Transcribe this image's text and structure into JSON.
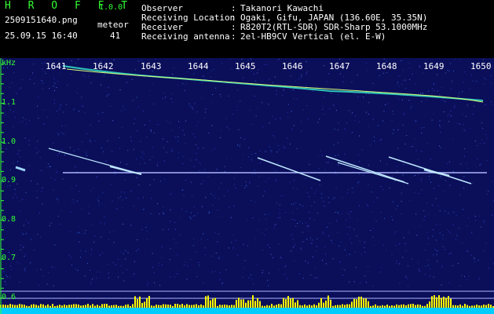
{
  "header": {
    "app_title": "H R O F F T",
    "app_version": "1.0.0",
    "filename": "2509151640.png",
    "meteor_label": "meteor",
    "datetime": "25.09.15 16:40",
    "meteor_count": "41",
    "info": [
      {
        "label": "Observer",
        "sep": ":",
        "value": "Takanori Kawachi"
      },
      {
        "label": "Receiving Location",
        "sep": ":",
        "value": "Ogaki, Gifu, JAPAN (136.60E, 35.35N)"
      },
      {
        "label": "Receiver",
        "sep": ":",
        "value": "R820T2(RTL-SDR) SDR-Sharp 53.1000MHz"
      },
      {
        "label": "Receiving antenna",
        "sep": ":",
        "value": "2el-HB9CV Vertical (el. E-W)"
      }
    ]
  },
  "spectrogram": {
    "y_unit": "kHz",
    "y_ticks": [
      "1.1",
      "1.0",
      "0.9",
      "0.8",
      "0.7",
      "0.6"
    ],
    "time_ticks": [
      "1641",
      "1642",
      "1643",
      "1644",
      "1645",
      "1646",
      "1647",
      "1648",
      "1649",
      "1650"
    ],
    "colors": {
      "background": "#0b0f5a",
      "carrier": "#aeb6ff",
      "meteor_trace": "#bfe8ff",
      "tick_label": "#ffffff",
      "yaxis_label": "#33ff33",
      "activity_bar": "#ffff00",
      "activity_base": "#00ccff"
    }
  }
}
